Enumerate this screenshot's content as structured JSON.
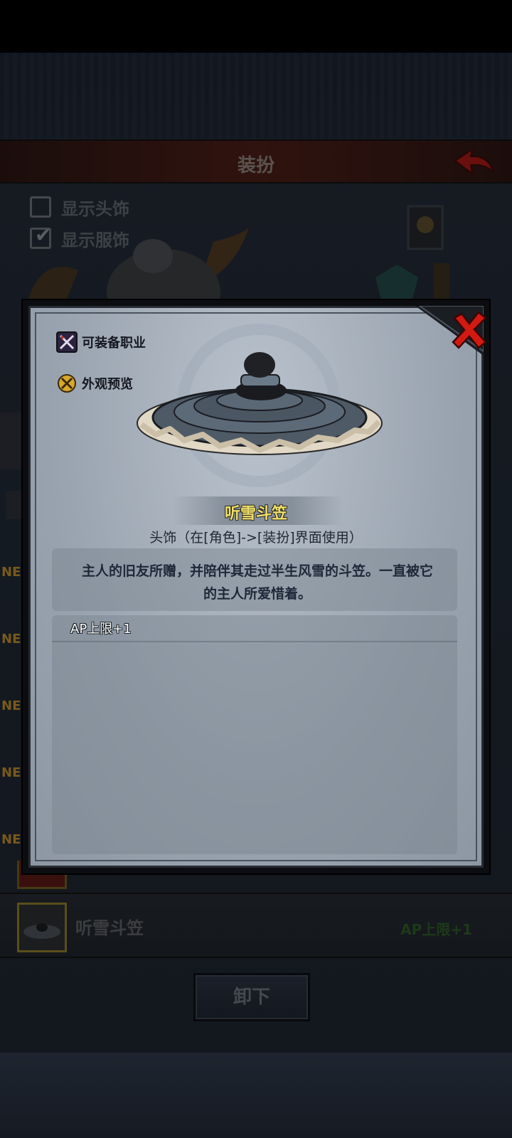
{
  "background": {
    "title": "装扮",
    "checkboxes": [
      {
        "label": "显示头饰",
        "checked": false
      },
      {
        "label": "显示服饰",
        "checked": true
      }
    ],
    "list_tags": [
      "NE",
      "NE",
      "NE",
      "NE",
      "NE"
    ],
    "bottom_item": {
      "name": "听雪斗笠",
      "stat": "AP上限+1"
    },
    "unequip_label": "卸下"
  },
  "popup": {
    "side_buttons": [
      {
        "label": "可装备职业",
        "icon": "class-swords-icon"
      },
      {
        "label": "外观预览",
        "icon": "preview-tools-icon"
      }
    ],
    "item": {
      "name": "听雪斗笠",
      "type": "头饰（在[角色]->[装扮]界面使用）",
      "description": "主人的旧友所赠，并陪伴其走过半生风雪的斗笠。一直被它的主人所爱惜着。",
      "stat": "AP上限+1",
      "icon": "straw-hat-icon"
    }
  },
  "colors": {
    "item_name": "#f0e06a",
    "close_red": "#d11a12",
    "title_bar": "#4a1e17"
  }
}
